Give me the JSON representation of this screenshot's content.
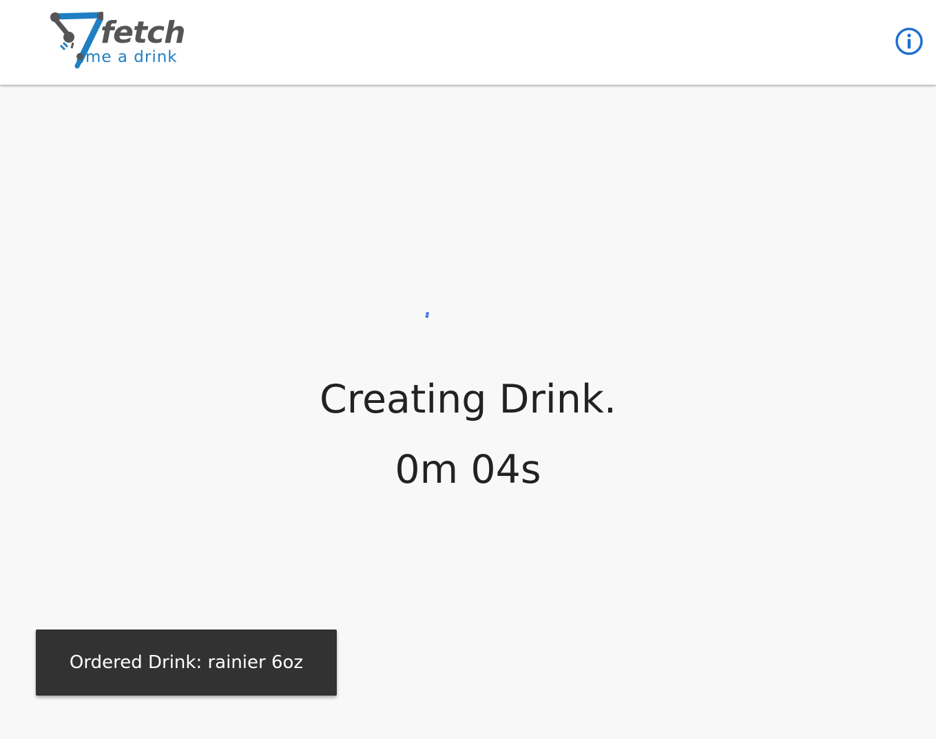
{
  "header": {
    "logo": {
      "word_main": "fetch",
      "word_sub": "me a drink",
      "icon": "robot-arm-seven-icon",
      "colors": {
        "accent_blue": "#1f7fc2",
        "dark_gray": "#555558"
      }
    },
    "info_button": {
      "icon": "info-circle-icon",
      "color": "#1f6fd1"
    }
  },
  "main": {
    "spinner": {
      "icon": "loading-spinner-icon",
      "color": "#3b6fe8"
    },
    "status_title": "Creating Drink.",
    "elapsed": "0m 04s"
  },
  "snackbar": {
    "message": "Ordered Drink: rainier 6oz",
    "background": "#323232"
  }
}
